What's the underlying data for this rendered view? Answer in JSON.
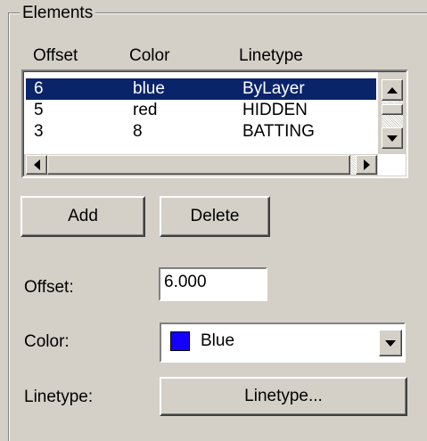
{
  "group": {
    "title": "Elements"
  },
  "list": {
    "headers": {
      "offset": "Offset",
      "color": "Color",
      "linetype": "Linetype"
    },
    "rows": [
      {
        "offset": "6",
        "color": "blue",
        "linetype": "ByLayer",
        "selected": true
      },
      {
        "offset": "5",
        "color": "red",
        "linetype": "HIDDEN",
        "selected": false
      },
      {
        "offset": "3",
        "color": "8",
        "linetype": "BATTING",
        "selected": false
      }
    ]
  },
  "buttons": {
    "add": "Add",
    "delete": "Delete"
  },
  "offset_field": {
    "label": "Offset:",
    "value": "6.000"
  },
  "color_field": {
    "label": "Color:",
    "value": "Blue",
    "swatch_color": "#1400ff"
  },
  "linetype_field": {
    "label": "Linetype:",
    "button": "Linetype..."
  },
  "colors": {
    "selection": "#0a246a",
    "panel": "#d4d0c8"
  }
}
